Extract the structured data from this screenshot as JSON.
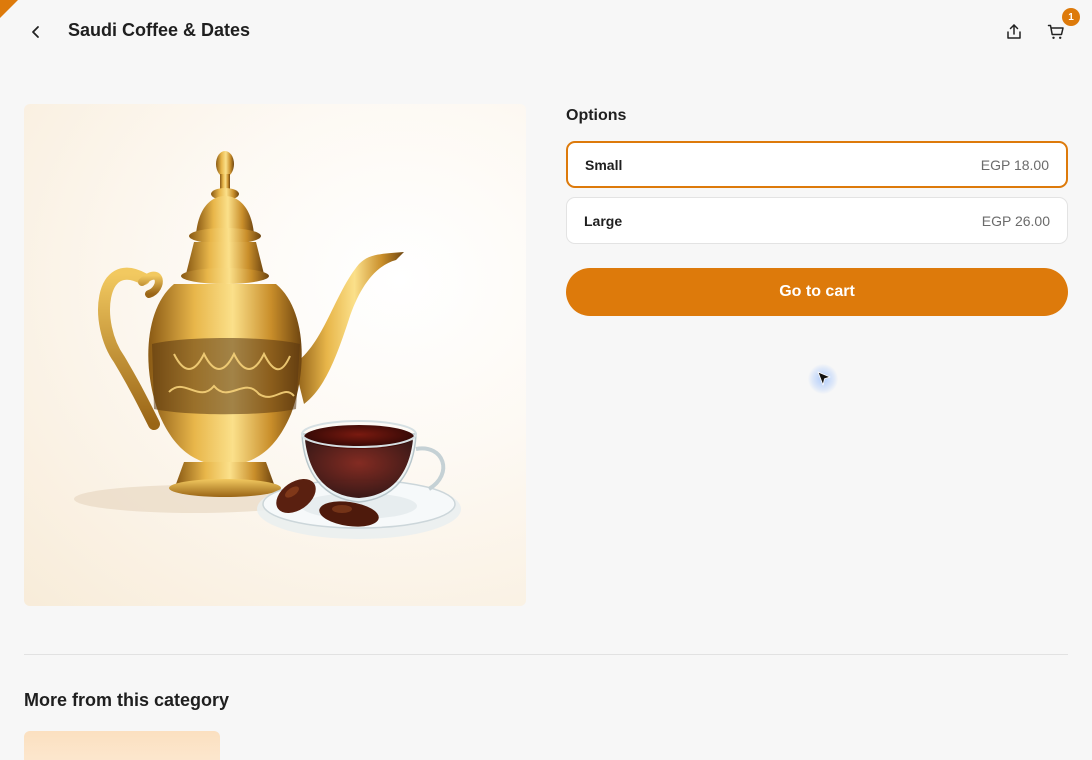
{
  "header": {
    "title": "Saudi Coffee & Dates",
    "back_icon": "chevron-left-icon",
    "share_icon": "share-icon",
    "cart_icon": "cart-icon",
    "cart_count": "1"
  },
  "product": {
    "image_alt": "Golden Arabic coffee pot (dallah) with a glass cup of coffee and dates"
  },
  "options": {
    "title": "Options",
    "items": [
      {
        "label": "Small",
        "price": "EGP 18.00",
        "selected": true
      },
      {
        "label": "Large",
        "price": "EGP 26.00",
        "selected": false
      }
    ]
  },
  "actions": {
    "go_to_cart": "Go to cart"
  },
  "more": {
    "title": "More from this category"
  },
  "colors": {
    "accent": "#dd7a0b",
    "background": "#f7f7f7"
  }
}
